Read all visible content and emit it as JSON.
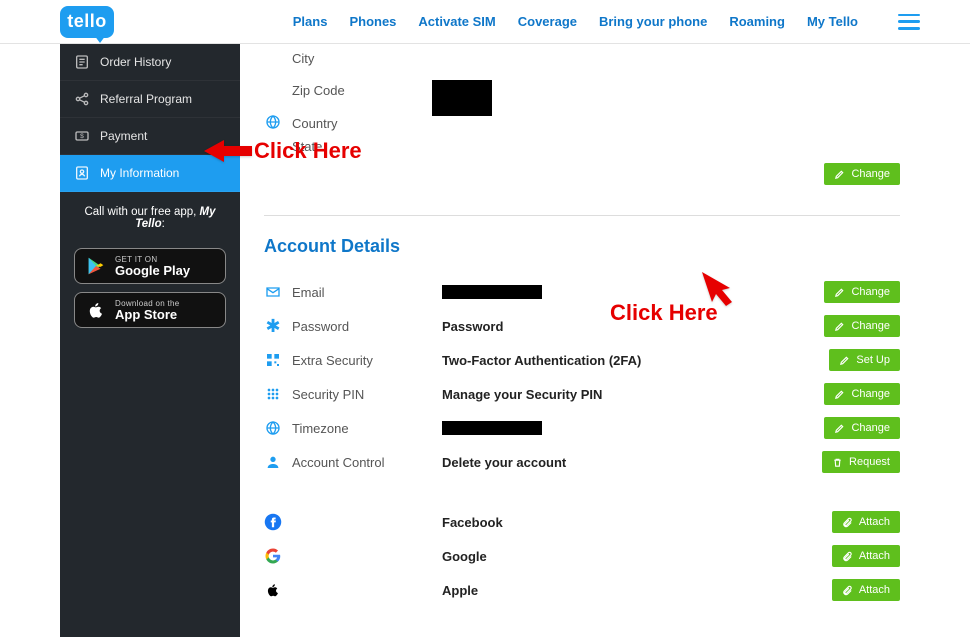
{
  "brand": "tello",
  "nav": [
    "Plans",
    "Phones",
    "Activate SIM",
    "Coverage",
    "Bring your phone",
    "Roaming",
    "My Tello"
  ],
  "sidebar": {
    "items": [
      {
        "label": "Order History"
      },
      {
        "label": "Referral Program"
      },
      {
        "label": "Payment"
      },
      {
        "label": "My Information"
      }
    ],
    "promo_prefix": "Call with our free app, ",
    "promo_app": "My Tello",
    "promo_suffix": ":",
    "gplay_small": "GET IT ON",
    "gplay_big": "Google Play",
    "appstore_small": "Download on the",
    "appstore_big": "App Store"
  },
  "address": {
    "city_label": "City",
    "zip_label": "Zip Code",
    "country_label": "Country",
    "state_label": "State"
  },
  "section_title": "Account Details",
  "details": {
    "email_label": "Email",
    "password_label": "Password",
    "password_value": "Password",
    "extsec_label": "Extra Security",
    "extsec_value": "Two-Factor Authentication (2FA)",
    "pin_label": "Security PIN",
    "pin_value": "Manage your Security PIN",
    "tz_label": "Timezone",
    "acct_label": "Account Control",
    "acct_value": "Delete your account"
  },
  "social": {
    "fb": "Facebook",
    "gg": "Google",
    "ap": "Apple"
  },
  "buttons": {
    "change": "Change",
    "setup": "Set Up",
    "request": "Request",
    "attach": "Attach"
  },
  "annotations": {
    "click1": "Click Here",
    "click2": "Click Here"
  }
}
